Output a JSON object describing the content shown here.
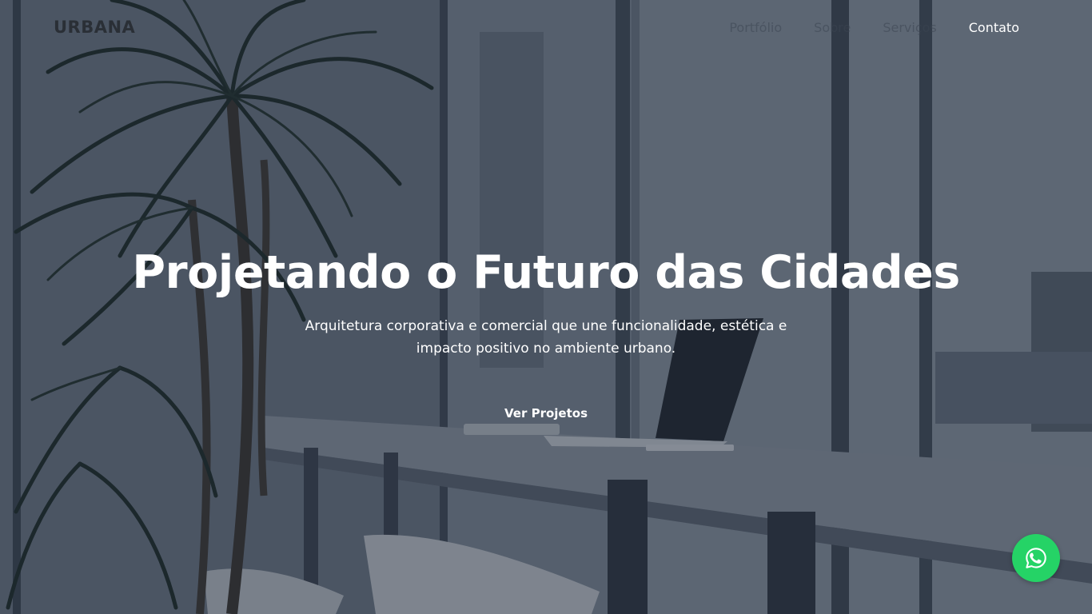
{
  "brand": {
    "logo_text": "URBANA"
  },
  "nav": {
    "links": [
      {
        "label": "Portfólio",
        "active": false
      },
      {
        "label": "Sobre",
        "active": false
      },
      {
        "label": "Serviços",
        "active": false
      },
      {
        "label": "Contato",
        "active": true
      }
    ]
  },
  "hero": {
    "title": "Projetando o Futuro das Cidades",
    "subtitle": "Arquitetura corporativa e comercial que une funcionalidade, estética e impacto positivo no ambiente urbano.",
    "cta_label": "Ver Projetos",
    "background_description_icon": "office-window-photo"
  },
  "whatsapp": {
    "icon": "whatsapp-icon",
    "color": "#25d366"
  },
  "colors": {
    "overlay": "#1c2634",
    "text_primary": "#ffffff",
    "logo": "#2a2f36"
  }
}
